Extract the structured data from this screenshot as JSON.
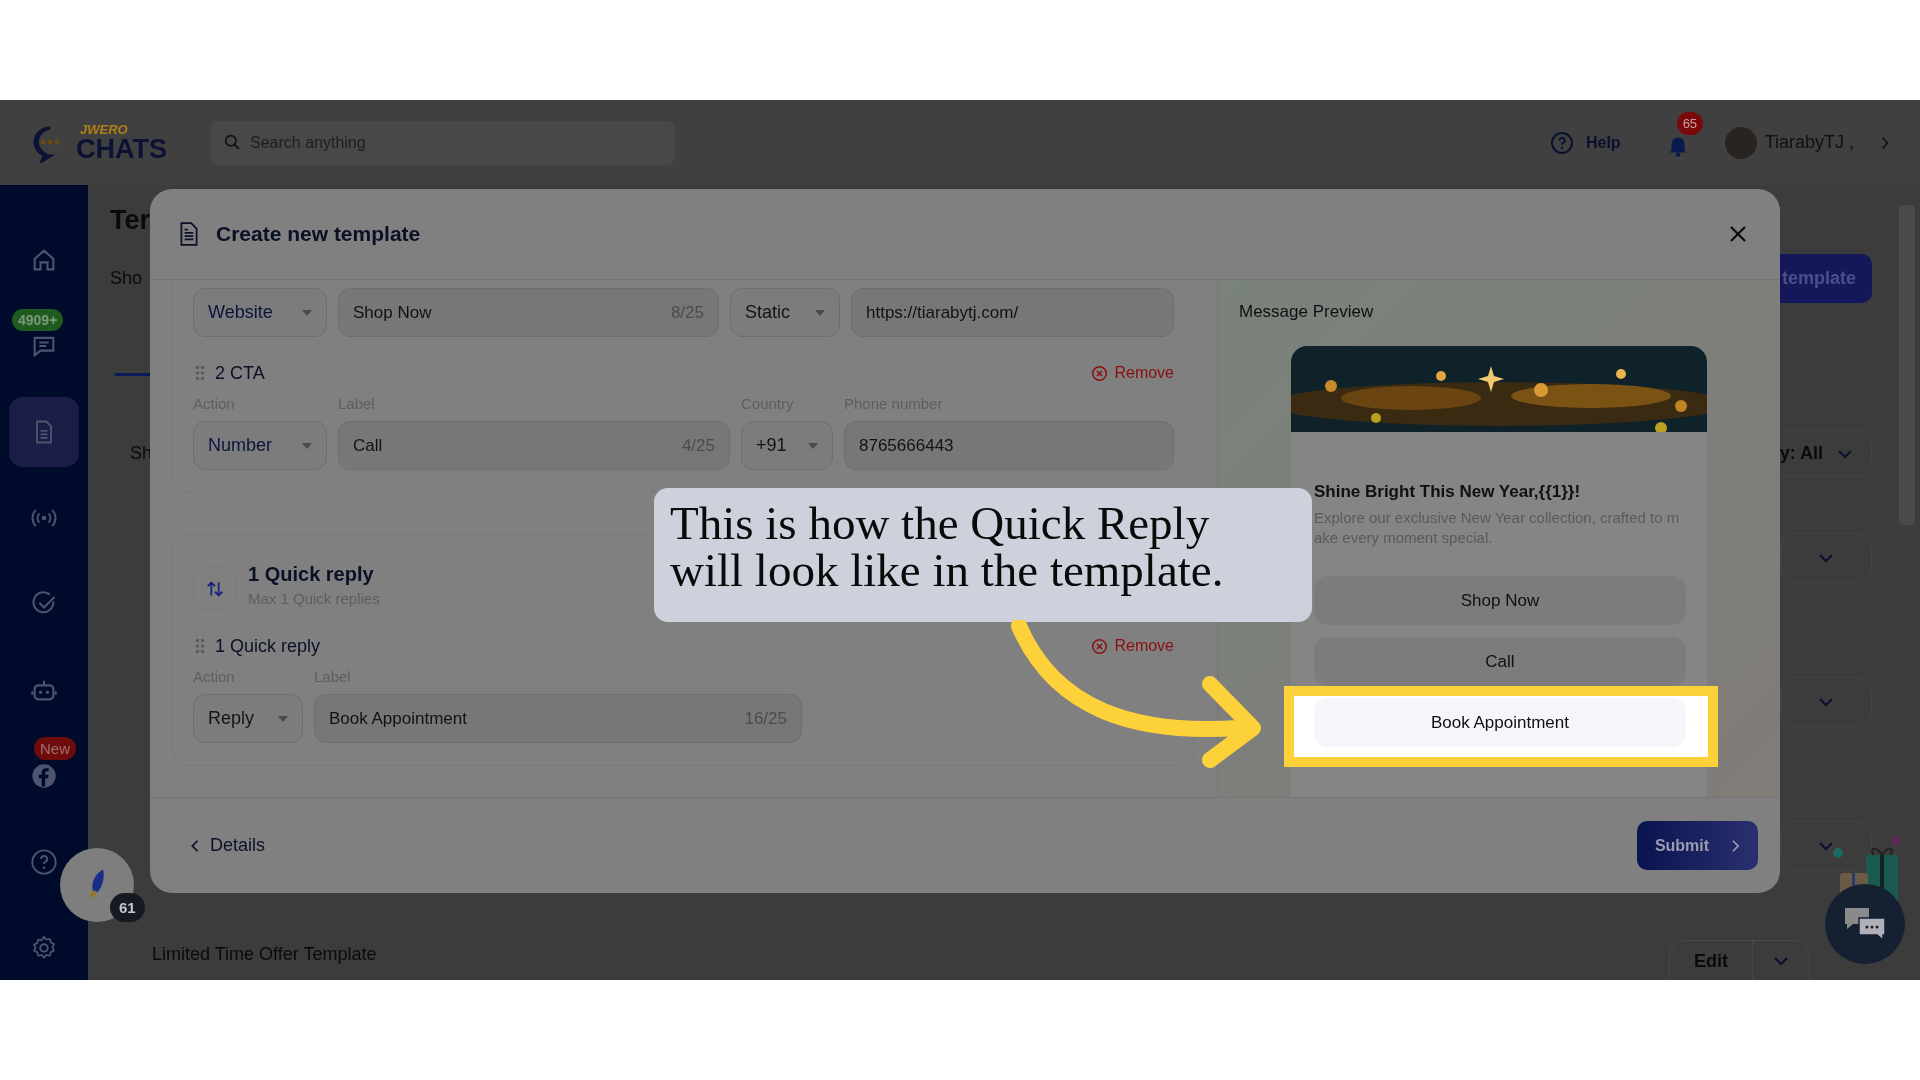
{
  "topbar": {
    "logo_small": "JWERO",
    "logo": "CHATS",
    "search": {
      "placeholder": "Search anything"
    },
    "help": "Help",
    "notifications": "65",
    "user": "TiarabyTJ ,"
  },
  "sidebar": {
    "items": [
      {
        "kind": "home",
        "selected": false
      },
      {
        "kind": "chats",
        "selected": false,
        "badge": {
          "text": "4909+",
          "color": "#1f5a1f"
        }
      },
      {
        "kind": "templates",
        "selected": true
      },
      {
        "kind": "broadcast",
        "selected": false
      },
      {
        "kind": "tasks",
        "selected": false
      },
      {
        "kind": "bot",
        "selected": false
      },
      {
        "kind": "facebook",
        "selected": false,
        "badge": {
          "text": "New",
          "color": "#6e0b0b"
        }
      },
      {
        "kind": "help",
        "selected": false
      },
      {
        "kind": "settings",
        "selected": false
      }
    ]
  },
  "launcher": {
    "badge": "61"
  },
  "page": {
    "title": "Ter",
    "subtitle": "Sho",
    "tab_text": "Sh",
    "create_button": "template",
    "filter": "y: All",
    "row_title": "Limited Time Offer Template",
    "edit_button": "Edit"
  },
  "modal": {
    "title": "Create new template",
    "website_row": {
      "action": "Website",
      "label": "Shop Now",
      "count": "8/25",
      "url_type": "Static",
      "url": "https://tiarabytj.com/"
    },
    "cta": {
      "heading": "2 CTA",
      "remove": "Remove",
      "labels": [
        "Action",
        "Label",
        "Country",
        "Phone number"
      ],
      "action": "Number",
      "label": "Call",
      "count": "4/25",
      "country": "+91",
      "phone": "8765666443"
    },
    "quick_reply": {
      "title": "1 Quick reply",
      "subtitle": "Max 1 Quick replies",
      "heading": "1 Quick reply",
      "remove": "Remove",
      "labels": [
        "Action",
        "Label"
      ],
      "action": "Reply",
      "label": "Book Appointment",
      "count": "16/25"
    },
    "preview": {
      "heading": "Message Preview",
      "title": "Shine Bright This New Year,{{1}}!",
      "body": "Explore our exclusive New Year collection, crafted to make every moment special.",
      "buttons": [
        {
          "label": "Shop Now",
          "highlighted": false
        },
        {
          "label": "Call",
          "highlighted": false
        },
        {
          "label": "Book Appointment",
          "highlighted": true
        }
      ]
    },
    "footer": {
      "back": "Details",
      "submit": "Submit"
    }
  },
  "callout": {
    "text": "This is how the Quick Reply\nwill look like in the template."
  }
}
